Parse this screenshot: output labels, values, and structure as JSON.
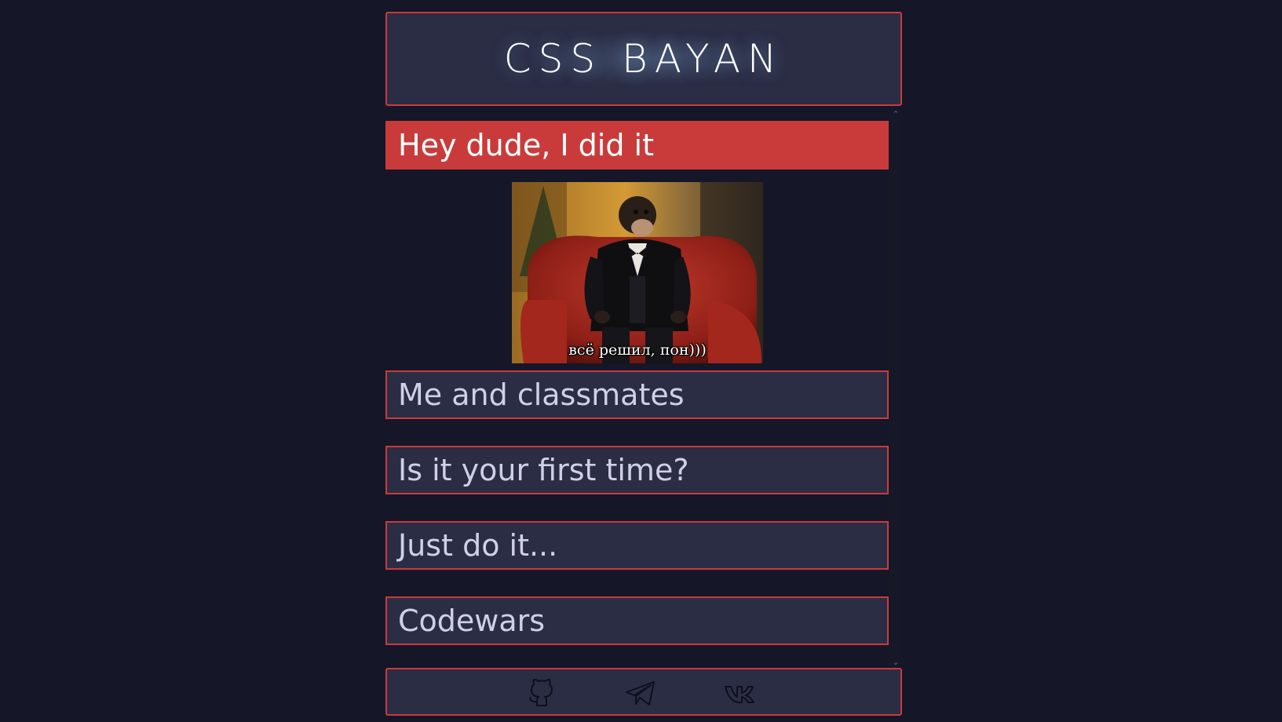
{
  "header": {
    "logo_text": "CSS BAYAN"
  },
  "accordion": {
    "items": [
      {
        "label": "Hey dude, I did it",
        "active": true,
        "meme_caption": "всё решил, пон)))"
      },
      {
        "label": "Me and classmates",
        "active": false
      },
      {
        "label": "Is it your first time?",
        "active": false
      },
      {
        "label": "Just do it...",
        "active": false
      },
      {
        "label": "Codewars",
        "active": false
      }
    ]
  },
  "footer": {
    "links": [
      {
        "icon": "github-icon"
      },
      {
        "icon": "telegram-icon"
      },
      {
        "icon": "vk-icon"
      }
    ]
  },
  "colors": {
    "background": "#151628",
    "surface": "#2b2d45",
    "accent": "#c93b3b",
    "text": "#cfd0e6"
  }
}
